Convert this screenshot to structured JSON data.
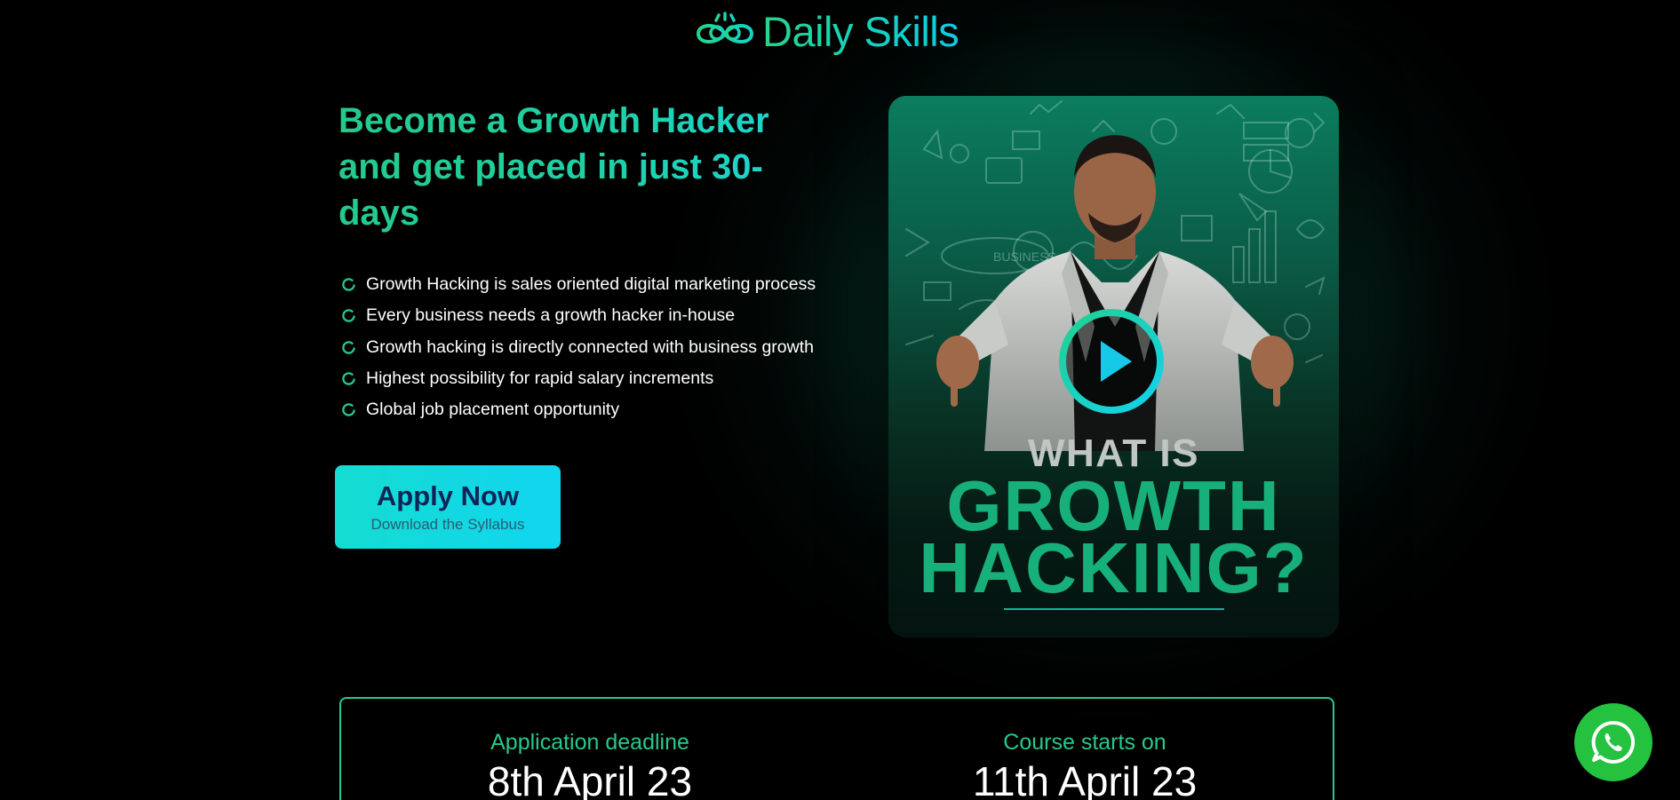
{
  "brand": {
    "name": "Daily Skills",
    "icon": "infinity-logo-icon"
  },
  "hero": {
    "headline": "Become a Growth Hacker and get placed in just 30-days",
    "bullets": [
      "Growth Hacking is sales oriented digital marketing process",
      "Every business needs a growth hacker in-house",
      "Growth hacking is directly connected with business growth",
      "Highest possibility for rapid salary increments",
      "Global job placement opportunity"
    ],
    "cta": {
      "title": "Apply Now",
      "subtitle": "Download the Syllabus"
    }
  },
  "video": {
    "line1": "WHAT IS",
    "line2": "GROWTH",
    "line3": "HACKING?",
    "play_icon": "play-icon"
  },
  "dates": {
    "deadline_label": "Application deadline",
    "deadline_value": "8th April 23",
    "start_label": "Course starts on",
    "start_value": "11th April 23"
  },
  "whatsapp": {
    "icon": "whatsapp-icon"
  },
  "colors": {
    "accent_green": "#25c98b",
    "accent_cyan": "#14d6e6",
    "cta_text": "#0f2456",
    "whatsapp": "#24c23f"
  }
}
